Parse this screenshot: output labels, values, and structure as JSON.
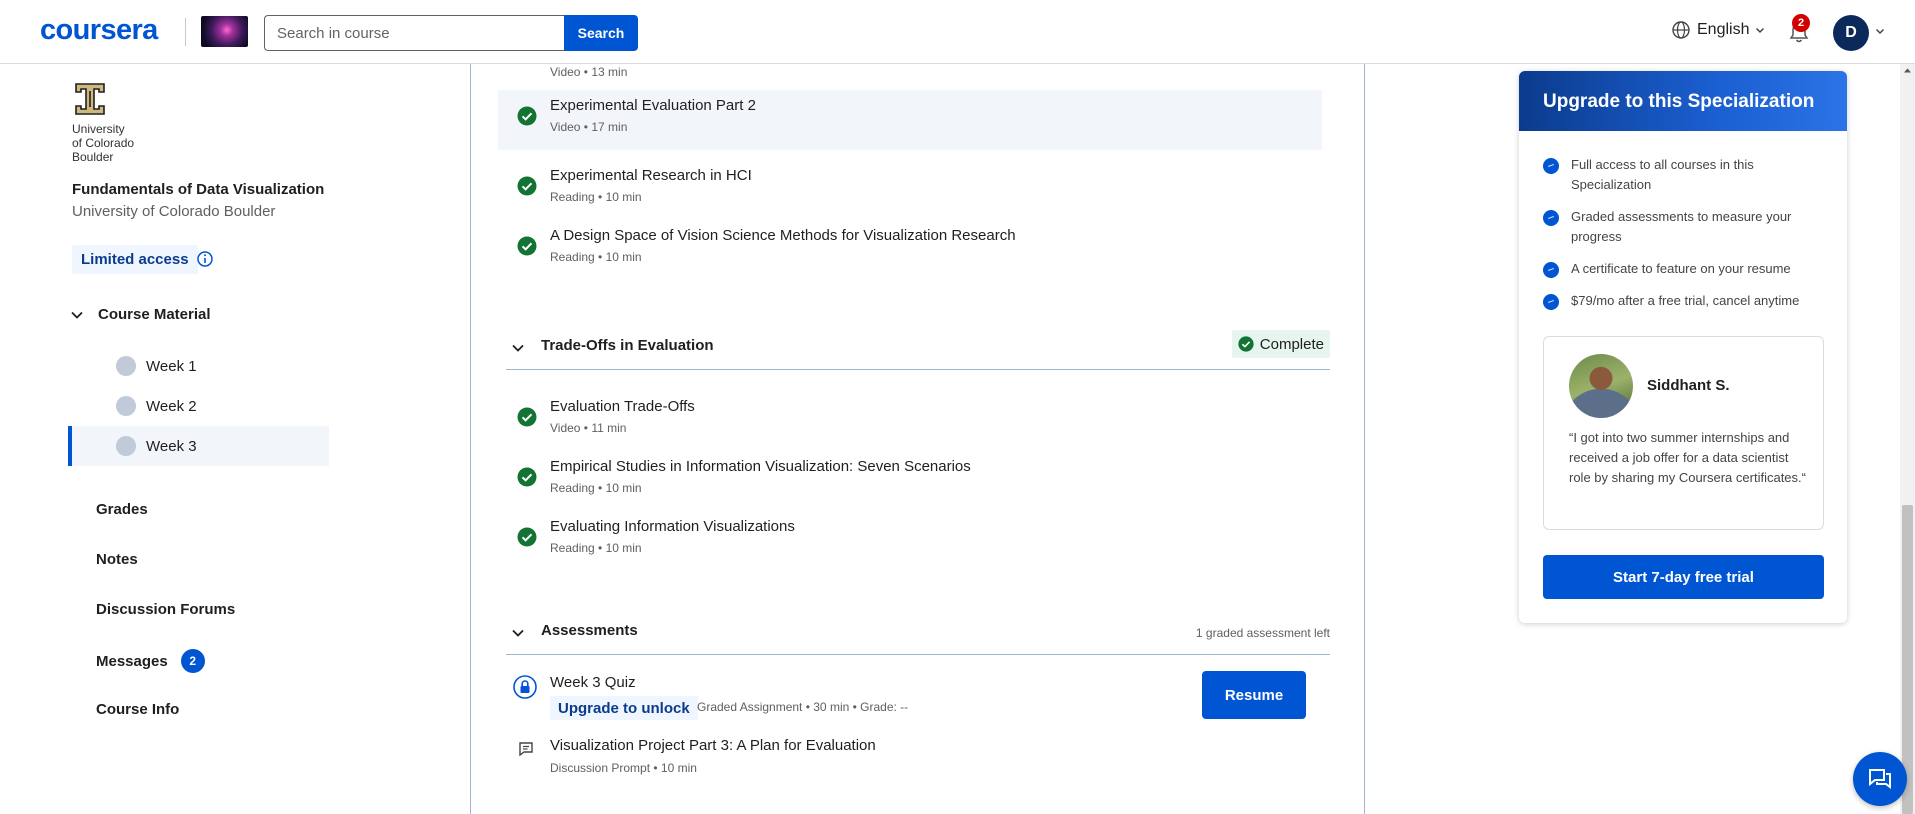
{
  "header": {
    "logo_text": "coursera",
    "search_placeholder": "Search in course",
    "search_button": "Search",
    "language": "English",
    "notification_count": "2",
    "avatar_initial": "D"
  },
  "sidebar": {
    "university_logo_text": "University\nof Colorado\nBoulder",
    "course_title": "Fundamentals of Data Visualization",
    "course_subtitle": "University of Colorado Boulder",
    "access_badge": "Limited access",
    "course_material_label": "Course Material",
    "weeks": [
      {
        "label": "Week 1",
        "active": false
      },
      {
        "label": "Week 2",
        "active": false
      },
      {
        "label": "Week 3",
        "active": true
      }
    ],
    "nav": [
      {
        "label": "Grades"
      },
      {
        "label": "Notes"
      },
      {
        "label": "Discussion Forums"
      },
      {
        "label": "Messages",
        "badge": "2"
      },
      {
        "label": "Course Info"
      }
    ]
  },
  "content": {
    "top_partial_meta": "Video • 13 min",
    "items_group1": [
      {
        "title": "Experimental Evaluation Part 2",
        "meta": "Video • 17 min",
        "highlighted": true
      },
      {
        "title": "Experimental Research in HCI",
        "meta": "Reading • 10 min"
      },
      {
        "title": "A Design Space of Vision Science Methods for Visualization Research",
        "meta": "Reading • 10 min"
      }
    ],
    "section_tradeoffs": {
      "title": "Trade-Offs in Evaluation",
      "status": "Complete"
    },
    "items_group2": [
      {
        "title": "Evaluation Trade-Offs",
        "meta": "Video • 11 min"
      },
      {
        "title": "Empirical Studies in Information Visualization: Seven Scenarios",
        "meta": "Reading • 10 min"
      },
      {
        "title": "Evaluating Information Visualizations",
        "meta": "Reading • 10 min"
      }
    ],
    "section_assessments": {
      "title": "Assessments",
      "graded_left": "1 graded assessment left"
    },
    "quiz": {
      "title": "Week 3 Quiz",
      "upgrade_label": "Upgrade to unlock",
      "meta": "Graded Assignment • 30 min • Grade: --",
      "resume_button": "Resume"
    },
    "discussion": {
      "title": "Visualization Project Part 3: A Plan for Evaluation",
      "meta": "Discussion Prompt • 10 min"
    }
  },
  "upgrade_card": {
    "title": "Upgrade to this Specialization",
    "benefits": [
      "Full access to all courses in this Specialization",
      "Graded assessments to measure your progress",
      "A certificate to feature on your resume",
      "$79/mo after a free trial, cancel anytime"
    ],
    "testimonial": {
      "name": "Siddhant S.",
      "quote": "“I got into two summer internships and received a job offer for a data scientist role by sharing my Coursera certificates.“"
    },
    "trial_button": "Start 7-day free trial"
  },
  "colors": {
    "brand_blue": "#0056d2",
    "success_green": "#137333",
    "badge_red": "#d30001"
  },
  "icons": {
    "language": "globe-icon",
    "notifications": "bell-icon",
    "info": "info-icon",
    "complete": "check-circle-icon",
    "locked": "lock-icon",
    "discussion": "discussion-icon",
    "chat": "chat-icon"
  }
}
